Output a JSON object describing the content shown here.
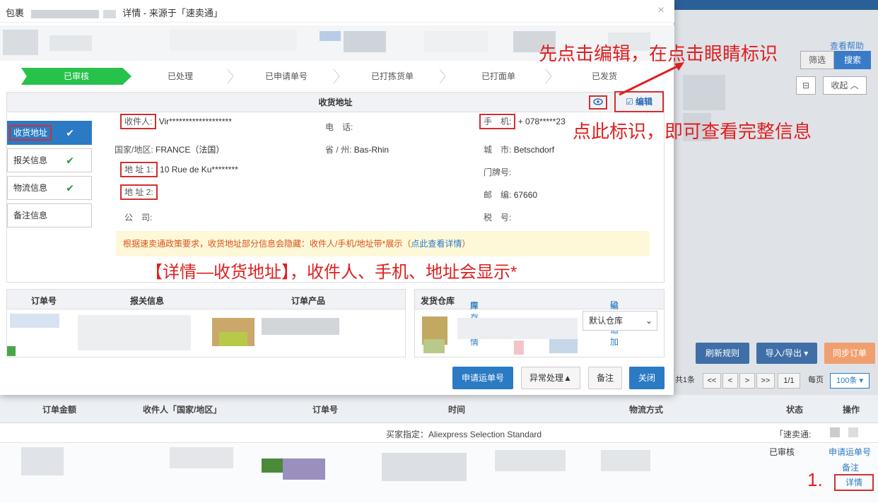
{
  "modal": {
    "title_prefix": "包裹",
    "title_suffix": "详情 - 来源于「速卖通」",
    "close_glyph": "×"
  },
  "steps": [
    "已审核",
    "已处理",
    "已申请单号",
    "已打拣货单",
    "已打面单",
    "已发货"
  ],
  "address": {
    "header": "收货地址",
    "edit_label": "编辑",
    "tabs": [
      {
        "label": "收货地址",
        "checked": true
      },
      {
        "label": "报关信息",
        "checked": true
      },
      {
        "label": "物流信息",
        "checked": true
      },
      {
        "label": "备注信息",
        "checked": false
      }
    ],
    "check_glyph": "✔",
    "fields": {
      "recipient_label": "收件人:",
      "recipient_value": "Vir*******************",
      "phone_label": "电　话:",
      "phone_value": "",
      "mobile_label": "手　机:",
      "mobile_value": "+ 078*****23",
      "country_label": "国家/地区:",
      "country_value": "FRANCE（法国）",
      "province_label": "省 / 州:",
      "province_value": "Bas-Rhin",
      "city_label": "城　市:",
      "city_value": "Betschdorf",
      "addr1_label": "地 址 1:",
      "addr1_value": "10 Rue de Ku********",
      "doorno_label": "门牌号:",
      "doorno_value": "",
      "addr2_label": "地 址 2:",
      "addr2_value": "",
      "zip_label": "邮　编:",
      "zip_value": "67660",
      "company_label": "公　司:",
      "company_value": "",
      "tax_label": "税　号:",
      "tax_value": ""
    },
    "notice_text": "根据速卖通政策要求，收货地址部分信息会隐藏：收件人/手机/地址带*展示（",
    "notice_link": "点此查看详情",
    "notice_end": "）",
    "caption": "【详情—收货地址】，收件人、手机、地址会显示*"
  },
  "orders": {
    "col_order_no": "订单号",
    "col_customs": "报关信息",
    "col_product": "订单产品",
    "warehouse_label": "发货仓库",
    "stock_detail": "库存详情",
    "edit_add": "编辑/追加",
    "warehouse_selected": "默认仓库"
  },
  "footer": {
    "apply_tracking": "申请运单号",
    "exception": "异常处理▲",
    "remark": "备注",
    "close": "关闭"
  },
  "background": {
    "help": "查看帮助",
    "filter": "筛选",
    "search": "搜索",
    "collapse": "收起 ︿",
    "refresh_rules": "刷新规则",
    "import_export": "导入/导出 ▾",
    "sync_orders": "同步订单",
    "pager": {
      "total": "共1条",
      "first": "<<",
      "prev": "<",
      "next": ">",
      "last": ">>",
      "page": "1/1",
      "per_page_label": "每页",
      "per_page": "100条 ▾"
    },
    "table_headers": [
      "订单金额",
      "收件人「国家/地区」",
      "订单号",
      "时间",
      "物流方式",
      "状态",
      "操作"
    ],
    "buyer_spec": "买家指定：Aliexpress Selection Standard",
    "source": "「速卖通:",
    "status": "已审核",
    "ops": [
      "申请运单号",
      "备注",
      "详情"
    ]
  },
  "annotations": {
    "top": "先点击编辑，在点击眼睛标识",
    "mid": "点此标识，即可查看完整信息",
    "step_num": "1."
  },
  "colors": {
    "accent": "#2b7ac4",
    "success": "#27c24c",
    "annotation_red": "#e01f1f"
  }
}
